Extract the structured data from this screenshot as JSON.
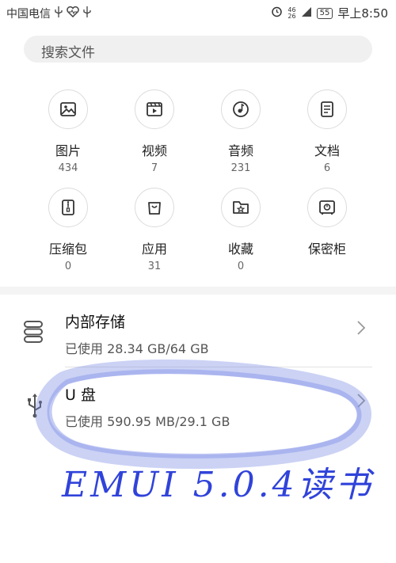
{
  "status_bar": {
    "carrier": "中国电信",
    "signal_top": "46",
    "signal_bottom": "26",
    "battery": "55",
    "time": "早上8:50"
  },
  "search": {
    "placeholder": "搜索文件"
  },
  "categories": [
    {
      "label": "图片",
      "count": "434",
      "icon": "image-icon"
    },
    {
      "label": "视频",
      "count": "7",
      "icon": "video-icon"
    },
    {
      "label": "音频",
      "count": "231",
      "icon": "music-icon"
    },
    {
      "label": "文档",
      "count": "6",
      "icon": "document-icon"
    },
    {
      "label": "压缩包",
      "count": "0",
      "icon": "archive-icon"
    },
    {
      "label": "应用",
      "count": "31",
      "icon": "app-bag-icon"
    },
    {
      "label": "收藏",
      "count": "0",
      "icon": "favorite-folder-icon"
    },
    {
      "label": "保密柜",
      "count": "",
      "icon": "safe-icon"
    }
  ],
  "storage": [
    {
      "title": "内部存储",
      "usage": "已使用 28.34 GB/64 GB",
      "icon": "internal-storage-icon"
    },
    {
      "title": "U 盘",
      "usage": "已使用 590.95 MB/29.1 GB",
      "icon": "usb-icon"
    }
  ],
  "annotation": {
    "text": "EMUI 5.0.4读书",
    "color": "#1a2fd6"
  }
}
